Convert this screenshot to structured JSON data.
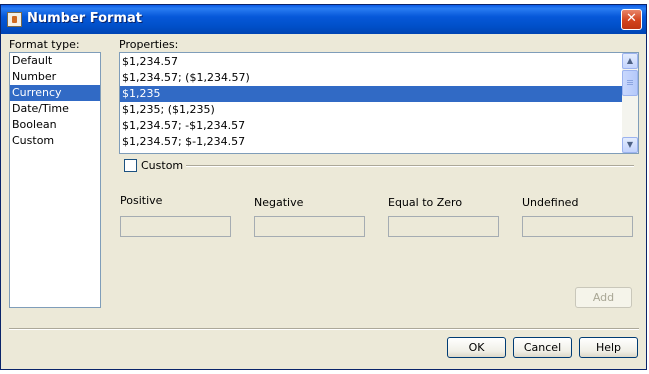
{
  "window": {
    "title": "Number Format",
    "close_glyph": "✕"
  },
  "format_type": {
    "label": "Format type:",
    "items": [
      "Default",
      "Number",
      "Currency",
      "Date/Time",
      "Boolean",
      "Custom"
    ],
    "selected": "Currency"
  },
  "properties": {
    "label": "Properties:",
    "items": [
      "$1,234.57",
      "$1,234.57; ($1,234.57)",
      "$1,235",
      "$1,235; ($1,235)",
      "$1,234.57; -$1,234.57",
      "$1,234.57; $-1,234.57"
    ],
    "selected": "$1,235"
  },
  "custom": {
    "label": "Custom",
    "checked": false
  },
  "fields": {
    "positive": {
      "label": "Positive",
      "value": ""
    },
    "negative": {
      "label": "Negative",
      "value": ""
    },
    "zero": {
      "label": "Equal to Zero",
      "value": ""
    },
    "undefined": {
      "label": "Undefined",
      "value": ""
    }
  },
  "buttons": {
    "add": "Add",
    "ok": "OK",
    "cancel": "Cancel",
    "help": "Help"
  },
  "colors": {
    "title_bar": "#0058e6",
    "selection": "#316ac5",
    "dialog_bg": "#ece9d8"
  }
}
